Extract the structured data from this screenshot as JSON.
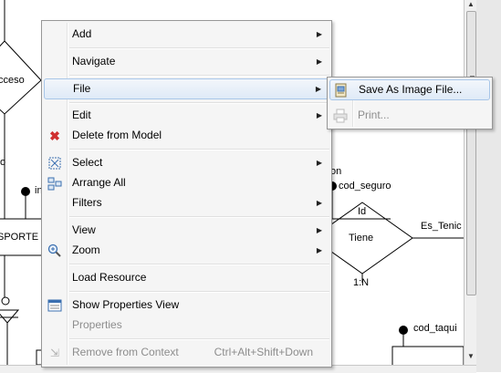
{
  "diagram": {
    "labels": [
      "cceso",
      "SPORTE",
      "Id",
      "Tiene",
      "Es_Tenic",
      "1:N",
      "on",
      "cod_seguro",
      "cod_taqui",
      "o",
      "in"
    ]
  },
  "context_menu": {
    "items": [
      {
        "label": "Add",
        "submenu": true
      },
      {
        "label": "Navigate",
        "submenu": true
      },
      {
        "label": "File",
        "submenu": true
      },
      {
        "label": "Edit",
        "submenu": true
      },
      {
        "label": "Delete from Model",
        "icon": "delete-icon"
      },
      {
        "label": "Select",
        "icon": "select-icon",
        "submenu": true
      },
      {
        "label": "Arrange All",
        "icon": "arrange-icon"
      },
      {
        "label": "Filters",
        "submenu": true
      },
      {
        "label": "View",
        "submenu": true
      },
      {
        "label": "Zoom",
        "icon": "zoom-icon",
        "submenu": true
      },
      {
        "label": "Load Resource"
      },
      {
        "label": "Show Properties View",
        "icon": "properties-view-icon"
      },
      {
        "label": "Properties",
        "disabled": true
      },
      {
        "label": "Remove from Context",
        "icon": "remove-context-icon",
        "disabled": true,
        "shortcut": "Ctrl+Alt+Shift+Down"
      }
    ]
  },
  "file_submenu": {
    "items": [
      {
        "label": "Save As Image File...",
        "icon": "save-image-icon"
      },
      {
        "label": "Print...",
        "icon": "print-icon",
        "disabled": true
      }
    ]
  },
  "colors": {
    "menu_bg": "#f5f5f5",
    "highlight_border": "#a8c6e8",
    "disabled_text": "#8d8d8d",
    "delete_red": "#d03030"
  }
}
